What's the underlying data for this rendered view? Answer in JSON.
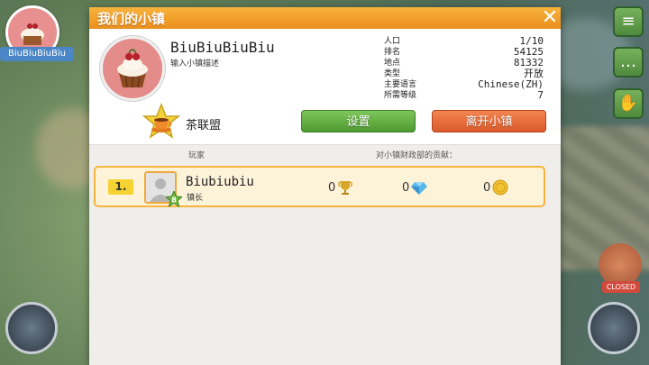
{
  "hud": {
    "player_name": "BiuBiuBiuBiu"
  },
  "dialog": {
    "title": "我们的小镇",
    "close_symbol": "✕",
    "town_name": "BiuBiuBiuBiu",
    "town_desc": "输入小镇描述",
    "info": [
      {
        "label": "人口",
        "value": "1/10"
      },
      {
        "label": "排名",
        "value": "54125"
      },
      {
        "label": "地点",
        "value": "81332"
      },
      {
        "label": "类型",
        "value": "开放"
      },
      {
        "label": "主要语言",
        "value": "Chinese(ZH)"
      },
      {
        "label": "所需等级",
        "value": "7"
      }
    ],
    "alliance_name": "茶联盟",
    "settings_label": "设置",
    "leave_label": "离开小镇",
    "col_player": "玩家",
    "col_contribution": "对小镇财政部的贡献：",
    "members": [
      {
        "rank": "1.",
        "name": "Biubiubiu",
        "role": "镇长",
        "level": "8",
        "trophies": "0",
        "diamonds": "0",
        "coins": "0"
      }
    ]
  },
  "side_icons": [
    "list-icon",
    "chat-icon",
    "handshake-icon"
  ],
  "closed_label": "CLOSED",
  "colors": {
    "title_orange": "#ec8f1d",
    "settings_green": "#4f9a32",
    "leave_orange": "#da5a2c",
    "row_border": "#f5b43d"
  }
}
